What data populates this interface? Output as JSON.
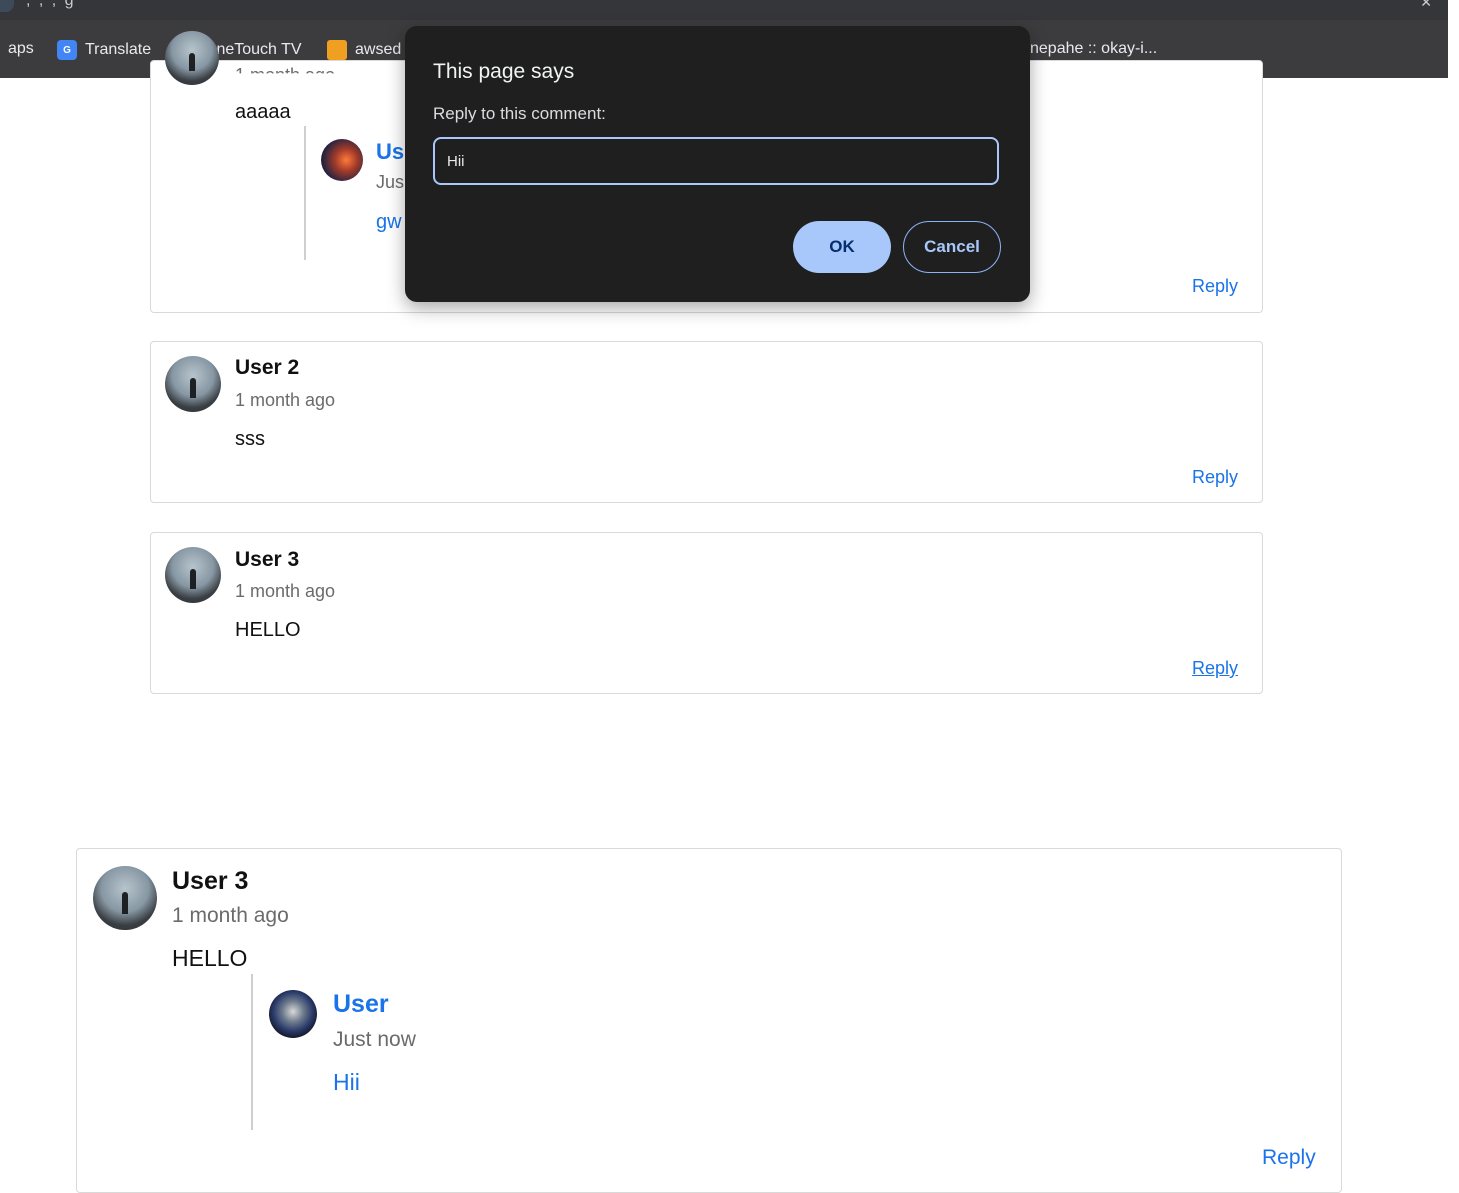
{
  "browser": {
    "title_fragment": ", , , g",
    "bookmarks": [
      {
        "label": "aps",
        "icon": "none"
      },
      {
        "label": "Translate",
        "icon": "google-translate-icon"
      },
      {
        "label": "OneTouch TV",
        "icon": "tv-icon"
      },
      {
        "label": "awsed",
        "icon": "aws-box-icon"
      },
      {
        "label": "nepahe :: okay-i...",
        "icon": "none"
      }
    ]
  },
  "dialog": {
    "title": "This page says",
    "message": "Reply to this comment:",
    "input_value": "Hii",
    "ok_label": "OK",
    "cancel_label": "Cancel"
  },
  "comments_top": [
    {
      "time_fragment": "1 month ago",
      "text": "aaaaa",
      "reply_label": "Reply",
      "nested": {
        "name": "Us",
        "time": "Jus",
        "text": "gw"
      }
    },
    {
      "name": "User 2",
      "time": "1 month ago",
      "text": "sss",
      "reply_label": "Reply"
    },
    {
      "name": "User 3",
      "time": "1 month ago",
      "text": "HELLO",
      "reply_label": "Reply"
    }
  ],
  "comment_bottom": {
    "name": "User 3",
    "time": "1 month ago",
    "text": "HELLO",
    "reply_label": "Reply",
    "nested": {
      "name": "User",
      "time": "Just now",
      "text": "Hii"
    }
  }
}
